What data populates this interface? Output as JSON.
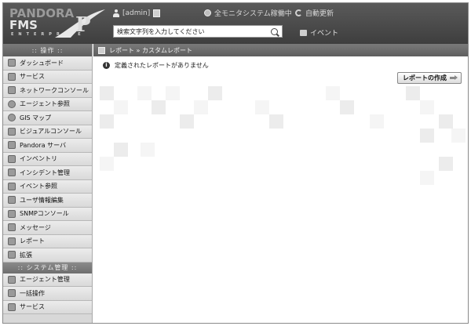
{
  "header": {
    "logo_line1": "PANDORA",
    "logo_line2": "FMS",
    "logo_line3": "ENTERPRISE",
    "user_label": "[admin]",
    "status_text": "全モニタシステム稼働中",
    "refresh_label": "自動更新",
    "search_placeholder": "検索文字列を入力してください",
    "events_label": "イベント"
  },
  "sidebar": {
    "operation_header": ":: 操作 ::",
    "items": [
      {
        "label": "ダッシュボード",
        "icon": "dashboard-icon"
      },
      {
        "label": "サービス",
        "icon": "services-icon"
      },
      {
        "label": "ネットワークコンソール",
        "icon": "network-console-icon"
      },
      {
        "label": "エージェント参照",
        "icon": "agent-view-icon"
      },
      {
        "label": "GIS マップ",
        "icon": "gis-map-icon"
      },
      {
        "label": "ビジュアルコンソール",
        "icon": "visual-console-icon"
      },
      {
        "label": "Pandora サーバ",
        "icon": "server-icon"
      },
      {
        "label": "インベントリ",
        "icon": "inventory-icon"
      },
      {
        "label": "インシデント管理",
        "icon": "incident-icon"
      },
      {
        "label": "イベント参照",
        "icon": "event-view-icon"
      },
      {
        "label": "ユーザ情報編集",
        "icon": "user-edit-icon"
      },
      {
        "label": "SNMPコンソール",
        "icon": "snmp-console-icon"
      },
      {
        "label": "メッセージ",
        "icon": "message-icon"
      },
      {
        "label": "レポート",
        "icon": "report-icon"
      },
      {
        "label": "拡張",
        "icon": "extension-icon"
      }
    ],
    "admin_header": ":: システム管理 ::",
    "admin_items": [
      {
        "label": "エージェント管理",
        "icon": "agent-manage-icon"
      },
      {
        "label": "一括操作",
        "icon": "bulk-operation-icon"
      },
      {
        "label": "サービス",
        "icon": "services-icon"
      }
    ]
  },
  "main": {
    "breadcrumb": "レポート » カスタムレポート",
    "notice": "定義されたレポートがありません",
    "create_button": "レポートの作成"
  },
  "colors": {
    "header_bg": "#4a4a4a",
    "sidebar_bg": "#d8d8d8",
    "bar_bg": "#6a6a6a"
  }
}
